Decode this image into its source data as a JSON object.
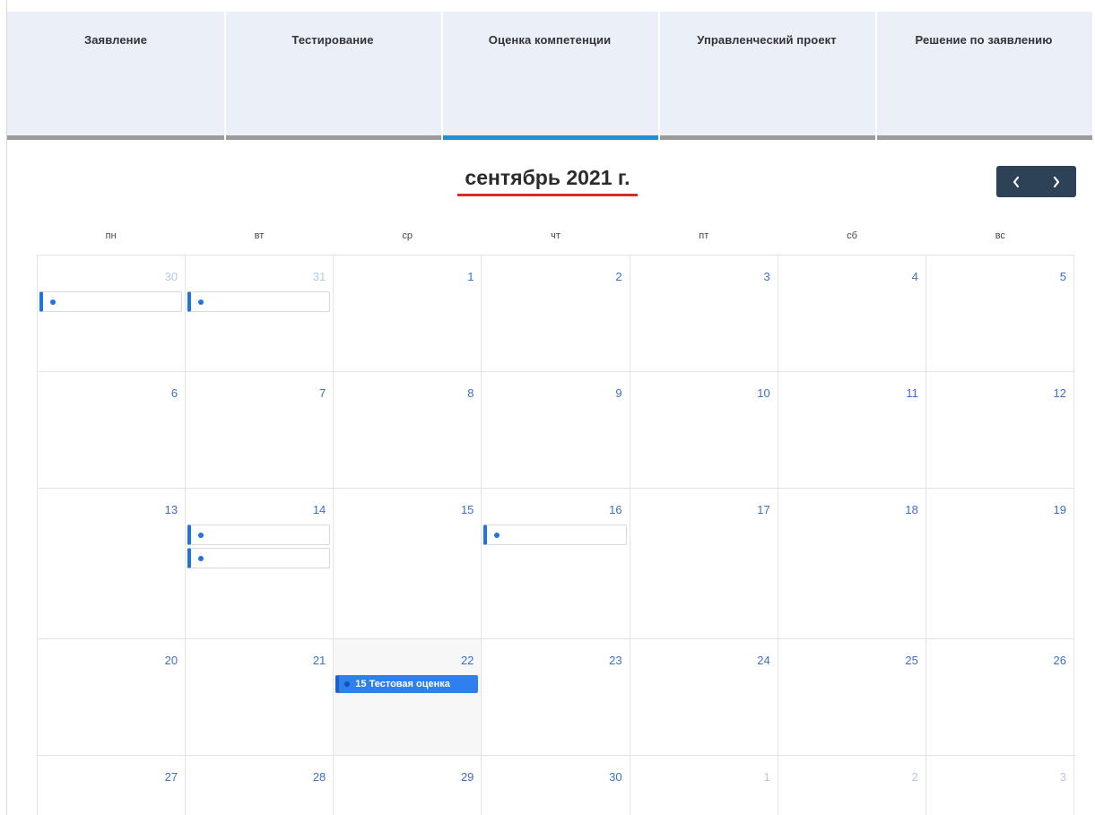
{
  "tabs": [
    {
      "label": "Заявление",
      "active": false
    },
    {
      "label": "Тестирование",
      "active": false
    },
    {
      "label": "Оценка компетенции",
      "active": true
    },
    {
      "label": "Управленческий проект",
      "active": false
    },
    {
      "label": "Решение по заявлению",
      "active": false
    }
  ],
  "calendar": {
    "title": "сентябрь 2021 г.",
    "weekdays": [
      "пн",
      "вт",
      "ср",
      "чт",
      "пт",
      "сб",
      "вс"
    ],
    "weeks": [
      [
        "30",
        "31",
        "1",
        "2",
        "3",
        "4",
        "5"
      ],
      [
        "6",
        "7",
        "8",
        "9",
        "10",
        "11",
        "12"
      ],
      [
        "13",
        "14",
        "15",
        "16",
        "17",
        "18",
        "19"
      ],
      [
        "20",
        "21",
        "22",
        "23",
        "24",
        "25",
        "26"
      ],
      [
        "27",
        "28",
        "29",
        "30",
        "1",
        "2",
        "3"
      ]
    ],
    "event_text": "15 Тестовая оценка "
  },
  "colors": {
    "active_tab": "#1f8fd8",
    "title_underline": "#d62b2b",
    "nav_bg": "#2e4257",
    "event": "#1e73e6"
  },
  "icons": {
    "prev": "chevron-left-icon",
    "next": "chevron-right-icon"
  }
}
